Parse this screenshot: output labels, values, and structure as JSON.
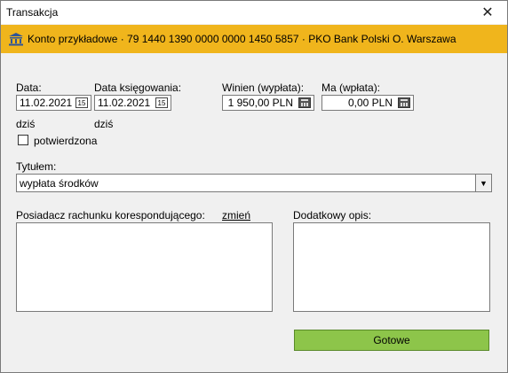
{
  "window": {
    "title": "Transakcja",
    "close_glyph": "✕"
  },
  "banner": {
    "text": "Konto przykładowe · 79 1440 1390 0000 0000 1450 5857 · PKO Bank Polski O. Warszawa",
    "color": "#f0b51c"
  },
  "form": {
    "date_label": "Data:",
    "date_value": "11.02.2021",
    "date_today": "dziś",
    "posting_date_label": "Data księgowania:",
    "posting_date_value": "11.02.2021",
    "posting_date_today": "dziś",
    "confirmed_label": "potwierdzona",
    "debit_label": "Winien (wypłata):",
    "debit_value": "1 950,00 PLN",
    "credit_label": "Ma (wpłata):",
    "credit_value": "0,00 PLN",
    "title_label": "Tytułem:",
    "title_value": "wypłata środków",
    "counterparty_label": "Posiadacz rachunku korespondującego:",
    "change_link": "zmień",
    "extra_desc_label": "Dodatkowy opis:",
    "calendar_glyph": "15",
    "dropdown_glyph": "▼"
  },
  "footer": {
    "done_label": "Gotowe",
    "done_color": "#8dc54a"
  }
}
